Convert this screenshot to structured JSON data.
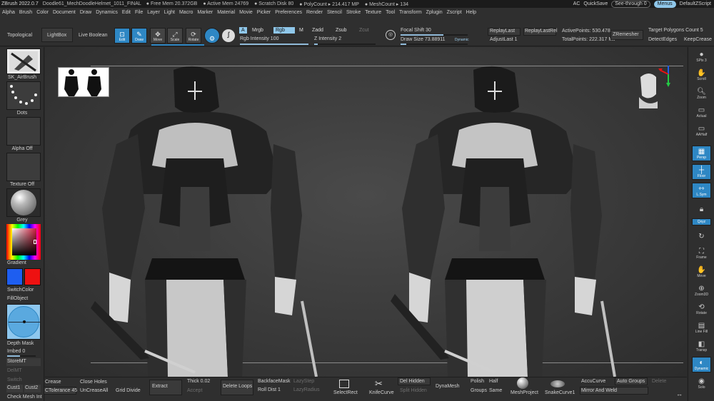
{
  "menubar": {
    "app_title": "ZBrush 2022.0.7",
    "document": "Doodle61_MechDoodleHelmet_1011_FINAL",
    "stats": [
      "● Free Mem 20.372GB",
      "● Active Mem 24769",
      "● Scratch Disk 80",
      "● PolyCount ▸ 214.417 MP",
      "● MeshCount ▸ 134"
    ],
    "items": [
      "Alpha",
      "Brush",
      "Color",
      "Document",
      "Draw",
      "Dynamics",
      "Edit",
      "File",
      "Layer",
      "Light",
      "Macro",
      "Marker",
      "Material",
      "Movie",
      "Picker",
      "Preferences",
      "Render",
      "Stencil",
      "Stroke",
      "Texture",
      "Tool",
      "Transform",
      "Zplugin",
      "Zscript",
      "Help"
    ],
    "ac": "AC",
    "quicksave": "QuickSave",
    "see_through": "See-through 0",
    "menus": "Menus",
    "default_zscript": "DefaultZScript"
  },
  "shelf": {
    "topological": "Topological",
    "lightbox": "LightBox",
    "live_boolean": "Live Boolean",
    "edit": "Edit",
    "draw": "Draw",
    "move": "Move",
    "scale": "Scale",
    "rotate": "Rotate",
    "a_label": "A",
    "mrgb": "Mrgb",
    "rgb": "Rgb",
    "m_label": "M",
    "zadd": "Zadd",
    "zsub": "Zsub",
    "zcut": "Zcut",
    "rgb_intensity": "Rgb Intensity 100",
    "z_intensity": "Z Intensity 2",
    "focal_shift": "Focal Shift 30",
    "draw_size": "Draw Size 73.88911",
    "dynamic": "Dynamic",
    "replay_last": "ReplayLast",
    "replay_last_rel": "ReplayLastRel",
    "adjust_last": "AdjustLast 1",
    "active_points": "ActivePoints: 530.478",
    "total_points": "TotalPoints: 222.317 Mil",
    "zremesher": "ZRemesher",
    "target_polygons": "Target Polygons Count 5",
    "detect_edges": "DetectEdges",
    "keep_creases": "KeepCrease"
  },
  "leftbar": {
    "brush_name": "SK_AirBrush",
    "stroke_name": "Dots",
    "alpha": "Alpha Off",
    "texture": "Texture Off",
    "material": "Grey",
    "gradient": "Gradient",
    "switch_color": "SwitchColor",
    "fill_object": "FillObject",
    "depth_mask": "Depth Mask",
    "imbed": "Imbed 0",
    "store_mt": "StoreMT",
    "del_mt": "DelMT",
    "switch": "Switch",
    "cust1": "Cust1",
    "cust2": "Cust2",
    "check_mesh": "Check Mesh Int"
  },
  "rightbar": {
    "buttons": [
      "SPix 3",
      "Scroll",
      "Zoom",
      "Actual",
      "AAHalf",
      "Persp",
      "Floor",
      "L.Sym",
      "",
      "Qxyz",
      "",
      "Frame",
      "Move",
      "Zoom3D",
      "Rotate",
      "Line Fill",
      "Transp",
      "Dynamic",
      "Solo"
    ]
  },
  "bottombar": {
    "crease": "Crease",
    "ctolerance": "CTolerance 45",
    "close_holes": "Close Holes",
    "uncrease_all": "UnCreaseAll",
    "grid_divide": "Grid Divide",
    "extract": "Extract",
    "thick": "Thick 0.02",
    "accept": "Accept",
    "delete_loops": "Delete Loops",
    "backface_mask": "BackfaceMask",
    "roll_dist": "Roll Dist 1",
    "lazy_step": "LazyStep",
    "lazy_radius": "LazyRadius",
    "select_rect": "SelectRect",
    "knife_curve": "KnifeCurve",
    "del_hidden": "Del Hidden",
    "split_hidden": "Split Hidden",
    "dyna_mesh": "DynaMesh",
    "polish": "Polish",
    "groups": "Groups",
    "half": "Half",
    "same": "Same",
    "mesh_project": "MeshProject",
    "snake_curve": "SnakeCurve1",
    "accu_curve": "AccuCurve",
    "mirror_and_weld": "Mirror And Weld",
    "auto_groups": "Auto Groups",
    "delete": "Delete"
  },
  "colors": {
    "accent": "#2e87c4",
    "highlight": "#8fc7ea",
    "primary_color": "#1e5ef0",
    "secondary_color": "#ee1111"
  }
}
